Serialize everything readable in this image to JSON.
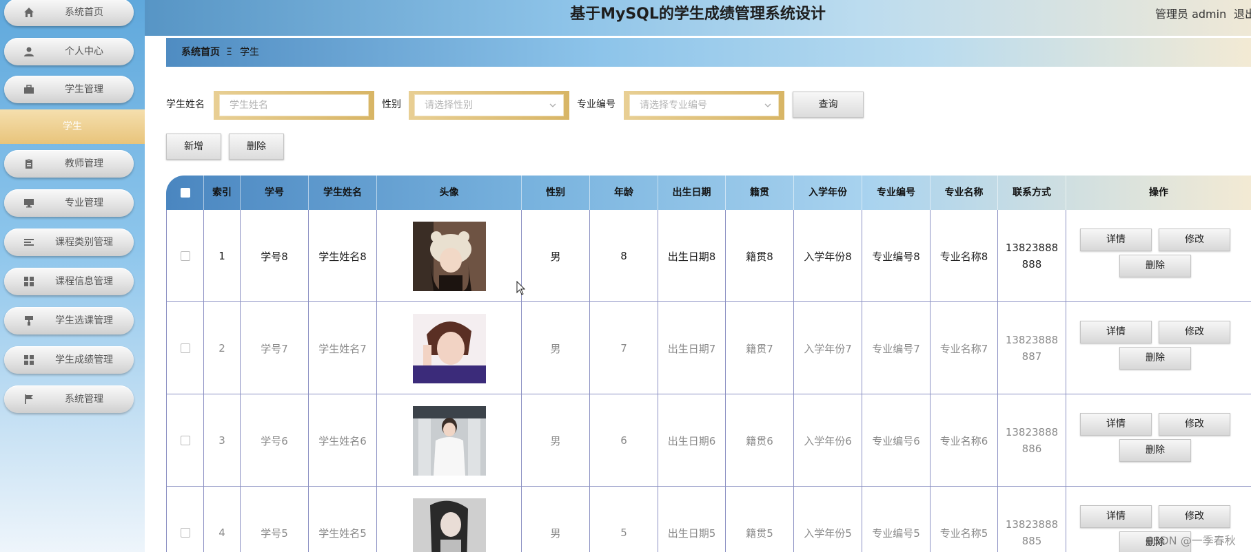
{
  "sidebar": {
    "items": [
      {
        "label": "系统首页",
        "icon": "home-icon"
      },
      {
        "label": "个人中心",
        "icon": "user-icon"
      },
      {
        "label": "学生管理",
        "icon": "briefcase-icon"
      },
      {
        "label": "教师管理",
        "icon": "clipboard-icon"
      },
      {
        "label": "专业管理",
        "icon": "monitor-icon"
      },
      {
        "label": "课程类别管理",
        "icon": "list-icon"
      },
      {
        "label": "课程信息管理",
        "icon": "grid-icon"
      },
      {
        "label": "学生选课管理",
        "icon": "paint-roller-icon"
      },
      {
        "label": "学生成绩管理",
        "icon": "grid-icon"
      },
      {
        "label": "系统管理",
        "icon": "flag-icon"
      }
    ],
    "active_sub": "学生"
  },
  "header": {
    "title": "基于MySQL的学生成绩管理系统设计",
    "user": "管理员 admin",
    "logout": "退出"
  },
  "breadcrumb": {
    "home": "系统首页",
    "sep": "Ξ",
    "current": "学生"
  },
  "search": {
    "name_label": "学生姓名",
    "name_placeholder": "学生姓名",
    "gender_label": "性别",
    "gender_placeholder": "请选择性别",
    "major_label": "专业编号",
    "major_placeholder": "请选择专业编号",
    "query_label": "查询"
  },
  "actions": {
    "add_label": "新增",
    "delete_label": "删除"
  },
  "table": {
    "headers": [
      "索引",
      "学号",
      "学生姓名",
      "头像",
      "性别",
      "年龄",
      "出生日期",
      "籍贯",
      "入学年份",
      "专业编号",
      "专业名称",
      "联系方式",
      "操作"
    ],
    "rows": [
      {
        "index": "1",
        "sid": "学号8",
        "name": "学生姓名8",
        "gender": "男",
        "age": "8",
        "birth": "出生日期8",
        "origin": "籍贯8",
        "year": "入学年份8",
        "major_no": "专业编号8",
        "major_name": "专业名称8",
        "phone_a": "13823888",
        "phone_b": "888"
      },
      {
        "index": "2",
        "sid": "学号7",
        "name": "学生姓名7",
        "gender": "男",
        "age": "7",
        "birth": "出生日期7",
        "origin": "籍贯7",
        "year": "入学年份7",
        "major_no": "专业编号7",
        "major_name": "专业名称7",
        "phone_a": "13823888",
        "phone_b": "887"
      },
      {
        "index": "3",
        "sid": "学号6",
        "name": "学生姓名6",
        "gender": "男",
        "age": "6",
        "birth": "出生日期6",
        "origin": "籍贯6",
        "year": "入学年份6",
        "major_no": "专业编号6",
        "major_name": "专业名称6",
        "phone_a": "13823888",
        "phone_b": "886"
      },
      {
        "index": "4",
        "sid": "学号5",
        "name": "学生姓名5",
        "gender": "男",
        "age": "5",
        "birth": "出生日期5",
        "origin": "籍贯5",
        "year": "入学年份5",
        "major_no": "专业编号5",
        "major_name": "专业名称5",
        "phone_a": "13823888",
        "phone_b": "885"
      }
    ],
    "op_detail": "详情",
    "op_edit": "修改",
    "op_delete": "删除"
  },
  "watermark": "CSDN @一季春秋",
  "colors": {
    "accent_gold": "#e8c47b",
    "header_blue": "#5795c5",
    "row_active_text": "#222222",
    "row_text": "#8a8a8a"
  }
}
